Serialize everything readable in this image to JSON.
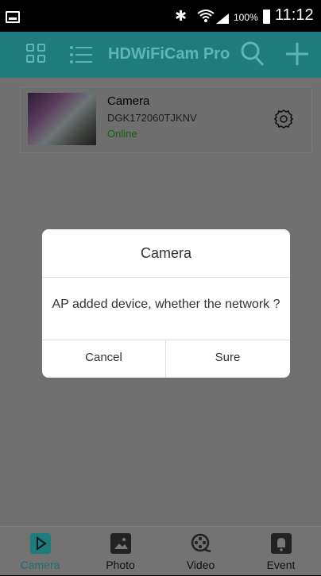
{
  "status_bar": {
    "battery_percent": "100%",
    "time": "11:12",
    "icons": [
      "image-notification-icon",
      "bluetooth-icon",
      "wifi-icon",
      "signal-icon",
      "battery-icon"
    ]
  },
  "app_bar": {
    "title": "HDWiFiCam Pro",
    "icons": [
      "grid-view-icon",
      "list-view-icon",
      "search-icon",
      "add-icon"
    ]
  },
  "camera_list": [
    {
      "name": "Camera",
      "id": "DGK172060TJKNV",
      "status": "Online"
    }
  ],
  "dialog": {
    "title": "Camera",
    "message": "AP added device, whether the network ?",
    "cancel_label": "Cancel",
    "confirm_label": "Sure"
  },
  "bottom_nav": {
    "items": [
      {
        "label": "Camera",
        "icon": "play-icon",
        "active": true
      },
      {
        "label": "Photo",
        "icon": "photo-icon",
        "active": false
      },
      {
        "label": "Video",
        "icon": "film-reel-icon",
        "active": false
      },
      {
        "label": "Event",
        "icon": "bell-icon",
        "active": false
      }
    ]
  },
  "colors": {
    "accent": "#1e7c7c",
    "accent_light": "#5fb5b4",
    "online_green": "#136113",
    "overlay_gray": "#707070"
  }
}
